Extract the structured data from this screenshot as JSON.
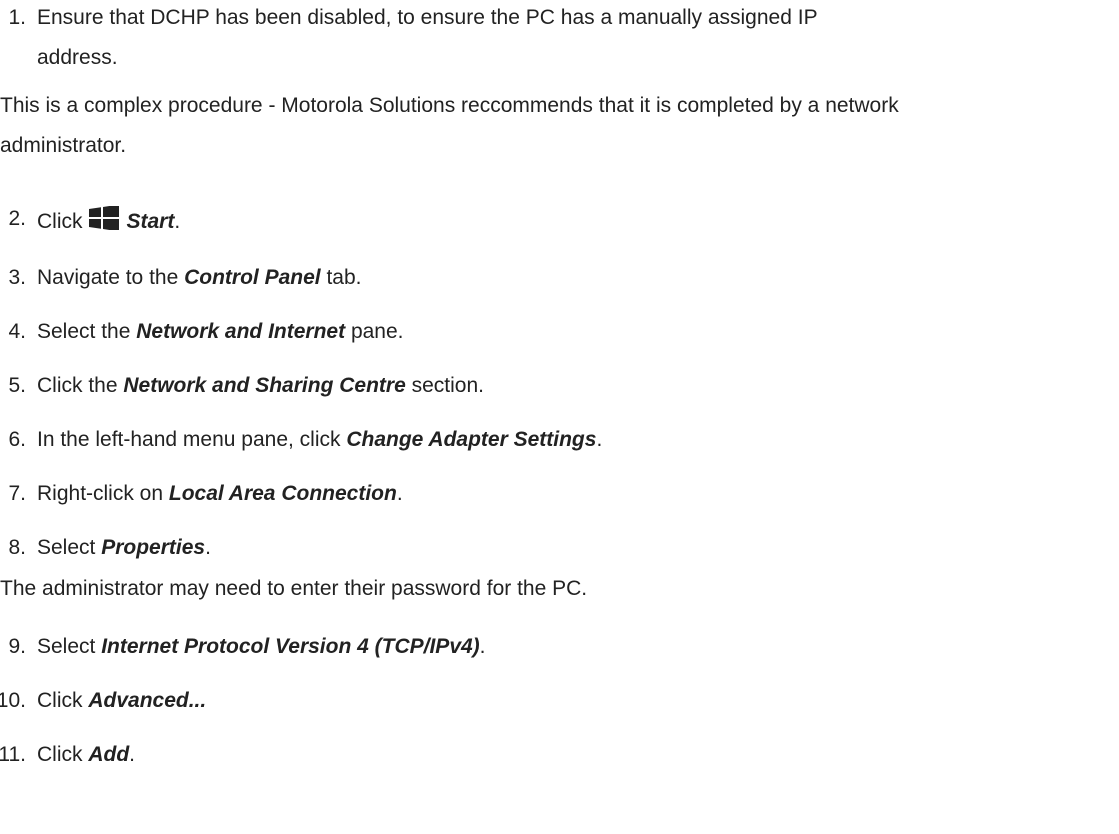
{
  "steps": [
    {
      "num": "1.",
      "line1": "Ensure that DCHP has been disabled, to ensure the PC has a manually assigned IP",
      "line2": "address."
    },
    {
      "num": "2.",
      "before": "Click",
      "icon": "windows-start-icon",
      "bold": "Start",
      "after": "."
    },
    {
      "num": "3.",
      "before": "Navigate to the ",
      "bold": "Control Panel",
      "after": " tab."
    },
    {
      "num": "4.",
      "before": "Select the ",
      "bold": "Network and Internet",
      "after": " pane."
    },
    {
      "num": "5.",
      "before": "Click the ",
      "bold": "Network and Sharing Centre",
      "after": " section."
    },
    {
      "num": "6.",
      "before": "In the left-hand menu pane, click ",
      "bold": "Change Adapter Settings",
      "after": "."
    },
    {
      "num": "7.",
      "before": "Right-click on ",
      "bold": "Local Area Connection",
      "after": "."
    },
    {
      "num": "8.",
      "before": "Select ",
      "bold": "Properties",
      "after": "."
    },
    {
      "num": "9.",
      "before": "Select ",
      "bold": "Internet Protocol Version 4 (TCP/IPv4)",
      "after": "."
    },
    {
      "num": "10.",
      "before": "Click ",
      "bold": "Advanced...",
      "after": ""
    },
    {
      "num": "11.",
      "before": "Click ",
      "bold": "Add",
      "after": "."
    }
  ],
  "notes": {
    "note1_line1": "This is a complex procedure - Motorola Solutions reccommends that it is completed by a network",
    "note1_line2": "administrator.",
    "note2": "The administrator may need to enter their password for the PC."
  },
  "colors": {
    "text": "#222222",
    "icon": "#222222"
  }
}
